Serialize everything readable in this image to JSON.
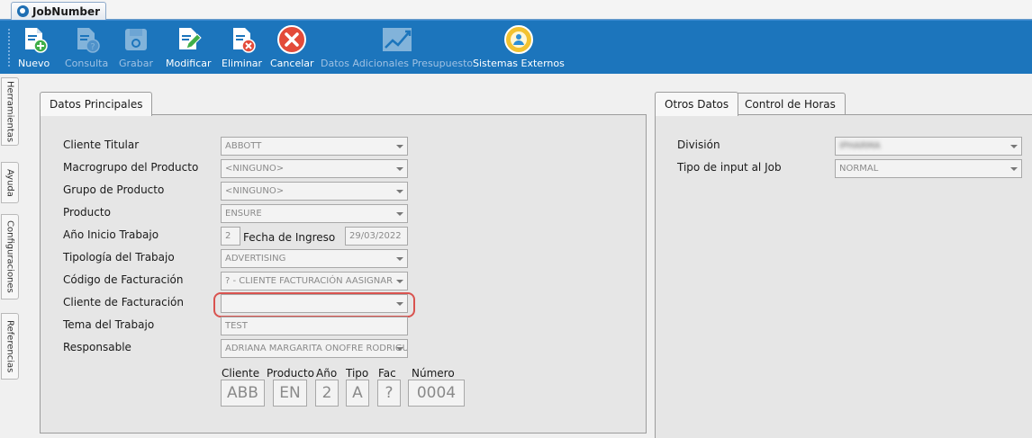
{
  "window": {
    "tab_title": "JobNumber"
  },
  "toolbar": {
    "buttons": [
      {
        "label": "Nuevo",
        "icon": "doc-plus-icon",
        "enabled": true
      },
      {
        "label": "Consulta",
        "icon": "doc-question-icon",
        "enabled": false
      },
      {
        "label": "Grabar",
        "icon": "save-icon",
        "enabled": false
      },
      {
        "label": "Modificar",
        "icon": "doc-edit-icon",
        "enabled": true
      },
      {
        "label": "Eliminar",
        "icon": "doc-delete-icon",
        "enabled": true
      },
      {
        "label": "Cancelar",
        "icon": "cancel-icon",
        "enabled": true
      },
      {
        "label": "Datos Adicionales Presupuesto",
        "icon": "chart-icon",
        "enabled": false
      },
      {
        "label": "Sistemas Externos",
        "icon": "external-systems-icon",
        "enabled": true
      }
    ]
  },
  "side_tabs": [
    "Herramientas",
    "Ayuda",
    "Configuraciones",
    "Referencias"
  ],
  "main_panel": {
    "tab": "Datos Principales",
    "fields": {
      "cliente_titular": {
        "label": "Cliente Titular",
        "value": "ABBOTT"
      },
      "macrogrupo": {
        "label": "Macrogrupo del Producto",
        "value": "<NINGUNO>"
      },
      "grupo": {
        "label": "Grupo de Producto",
        "value": "<NINGUNO>"
      },
      "producto": {
        "label": "Producto",
        "value": "ENSURE"
      },
      "anio_inicio": {
        "label": "Año Inicio Trabajo",
        "value": "2"
      },
      "fecha_ingreso": {
        "label": "Fecha de Ingreso",
        "value": "29/03/2022"
      },
      "tipologia": {
        "label": "Tipología del Trabajo",
        "value": "ADVERTISING"
      },
      "codigo_facturacion": {
        "label": "Código de Facturación",
        "value": "? - CLIENTE FACTURACIÓN AASIGNAR"
      },
      "cliente_facturacion": {
        "label": "Cliente de Facturación",
        "value": ""
      },
      "tema": {
        "label": "Tema del Trabajo",
        "value": "TEST"
      },
      "responsable": {
        "label": "Responsable",
        "value": "ADRIANA MARGARITA ONOFRE RODRIGUEZ"
      }
    },
    "job_code": {
      "headers": {
        "cliente": "Cliente",
        "producto": "Producto",
        "anio": "Año",
        "tipo": "Tipo",
        "fac": "Fac",
        "numero": "Número"
      },
      "values": {
        "cliente": "ABB",
        "producto": "EN",
        "anio": "2",
        "tipo": "A",
        "fac": "?",
        "numero": "0004"
      }
    }
  },
  "right_panel": {
    "tabs": [
      "Otros Datos",
      "Control de Horas"
    ],
    "fields": {
      "division": {
        "label": "División",
        "value": "IPHARMA"
      },
      "tipo_input": {
        "label": "Tipo de input al Job",
        "value": "NORMAL"
      }
    }
  },
  "colors": {
    "toolbar": "#1c75bc",
    "highlight": "#d9534f"
  }
}
